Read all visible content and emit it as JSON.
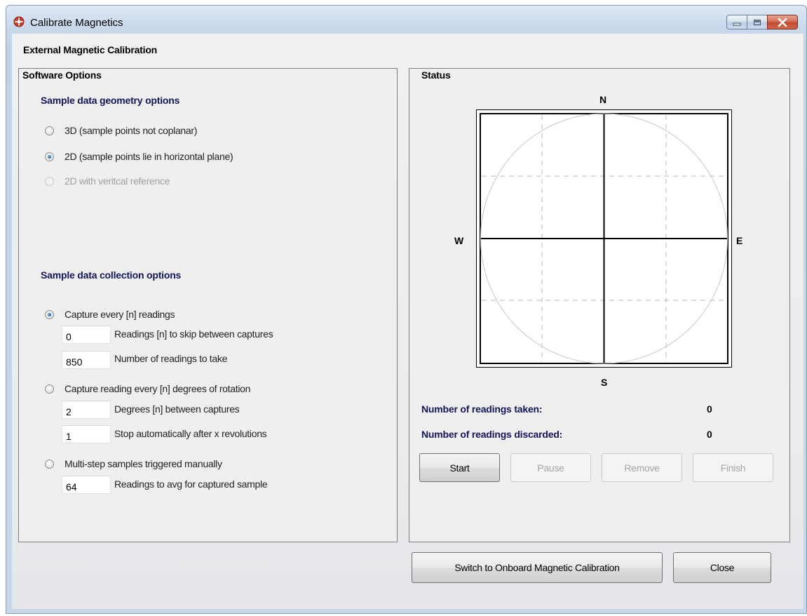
{
  "window": {
    "title": "Calibrate Magnetics"
  },
  "header": {
    "title": "External Magnetic Calibration"
  },
  "software_options": {
    "title": "Software Options",
    "geometry": {
      "title": "Sample data geometry options",
      "options": [
        {
          "label": "3D  (sample points not coplanar)",
          "checked": false,
          "enabled": true
        },
        {
          "label": "2D  (sample points lie in horizontal plane)",
          "checked": true,
          "enabled": true
        },
        {
          "label": "2D with veritcal reference",
          "checked": false,
          "enabled": false
        }
      ]
    },
    "collection": {
      "title": "Sample data collection options",
      "every_n": {
        "label": "Capture every [n] readings",
        "skip_value": "0",
        "skip_label": "Readings [n] to skip between captures",
        "count_value": "850",
        "count_label": "Number of readings to take"
      },
      "rotation": {
        "label": "Capture reading every [n] degrees of rotation",
        "degrees_value": "2",
        "degrees_label": "Degrees [n] between captures",
        "revs_value": "1",
        "revs_label": "Stop automatically after x revolutions"
      },
      "manual": {
        "label": "Multi-step samples triggered manually",
        "avg_value": "64",
        "avg_label": "Readings to avg for captured sample"
      }
    }
  },
  "status": {
    "title": "Status",
    "compass": {
      "n": "N",
      "s": "S",
      "e": "E",
      "w": "W"
    },
    "readings_taken_label": "Number of readings taken:",
    "readings_taken": "0",
    "readings_discarded_label": "Number of readings discarded:",
    "readings_discarded": "0",
    "buttons": {
      "start": "Start",
      "pause": "Pause",
      "remove": "Remove",
      "finish": "Finish"
    }
  },
  "footer": {
    "switch_label": "Switch to Onboard Magnetic Calibration",
    "close_label": "Close"
  },
  "icons": {
    "app": "lifebuoy-icon",
    "minimize": "minimize-icon",
    "maximize": "maximize-icon",
    "close": "close-icon"
  },
  "colors": {
    "section_title": "#14145a",
    "close_button": "#c34a2e"
  }
}
